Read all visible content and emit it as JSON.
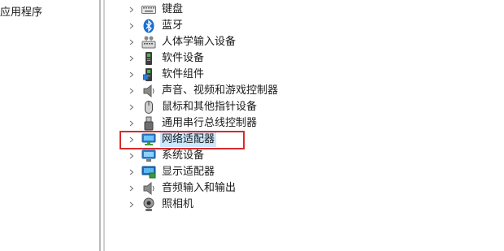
{
  "left_pane": {
    "text": "应用程序"
  },
  "tree": {
    "items": [
      {
        "label": "键盘",
        "icon": "keyboard-icon"
      },
      {
        "label": "蓝牙",
        "icon": "bluetooth-icon"
      },
      {
        "label": "人体学输入设备",
        "icon": "hid-icon"
      },
      {
        "label": "软件设备",
        "icon": "software-device-icon"
      },
      {
        "label": "软件组件",
        "icon": "software-component-icon"
      },
      {
        "label": "声音、视频和游戏控制器",
        "icon": "speaker-icon"
      },
      {
        "label": "鼠标和其他指针设备",
        "icon": "mouse-icon"
      },
      {
        "label": "通用串行总线控制器",
        "icon": "usb-icon"
      },
      {
        "label": "网络适配器",
        "icon": "network-adapter-icon",
        "selected": true
      },
      {
        "label": "系统设备",
        "icon": "system-device-icon"
      },
      {
        "label": "显示适配器",
        "icon": "display-adapter-icon"
      },
      {
        "label": "音频输入和输出",
        "icon": "audio-io-icon"
      },
      {
        "label": "照相机",
        "icon": "camera-icon"
      }
    ]
  },
  "colors": {
    "highlight_box": "#d62b2b",
    "selection": "#cce8ff"
  }
}
